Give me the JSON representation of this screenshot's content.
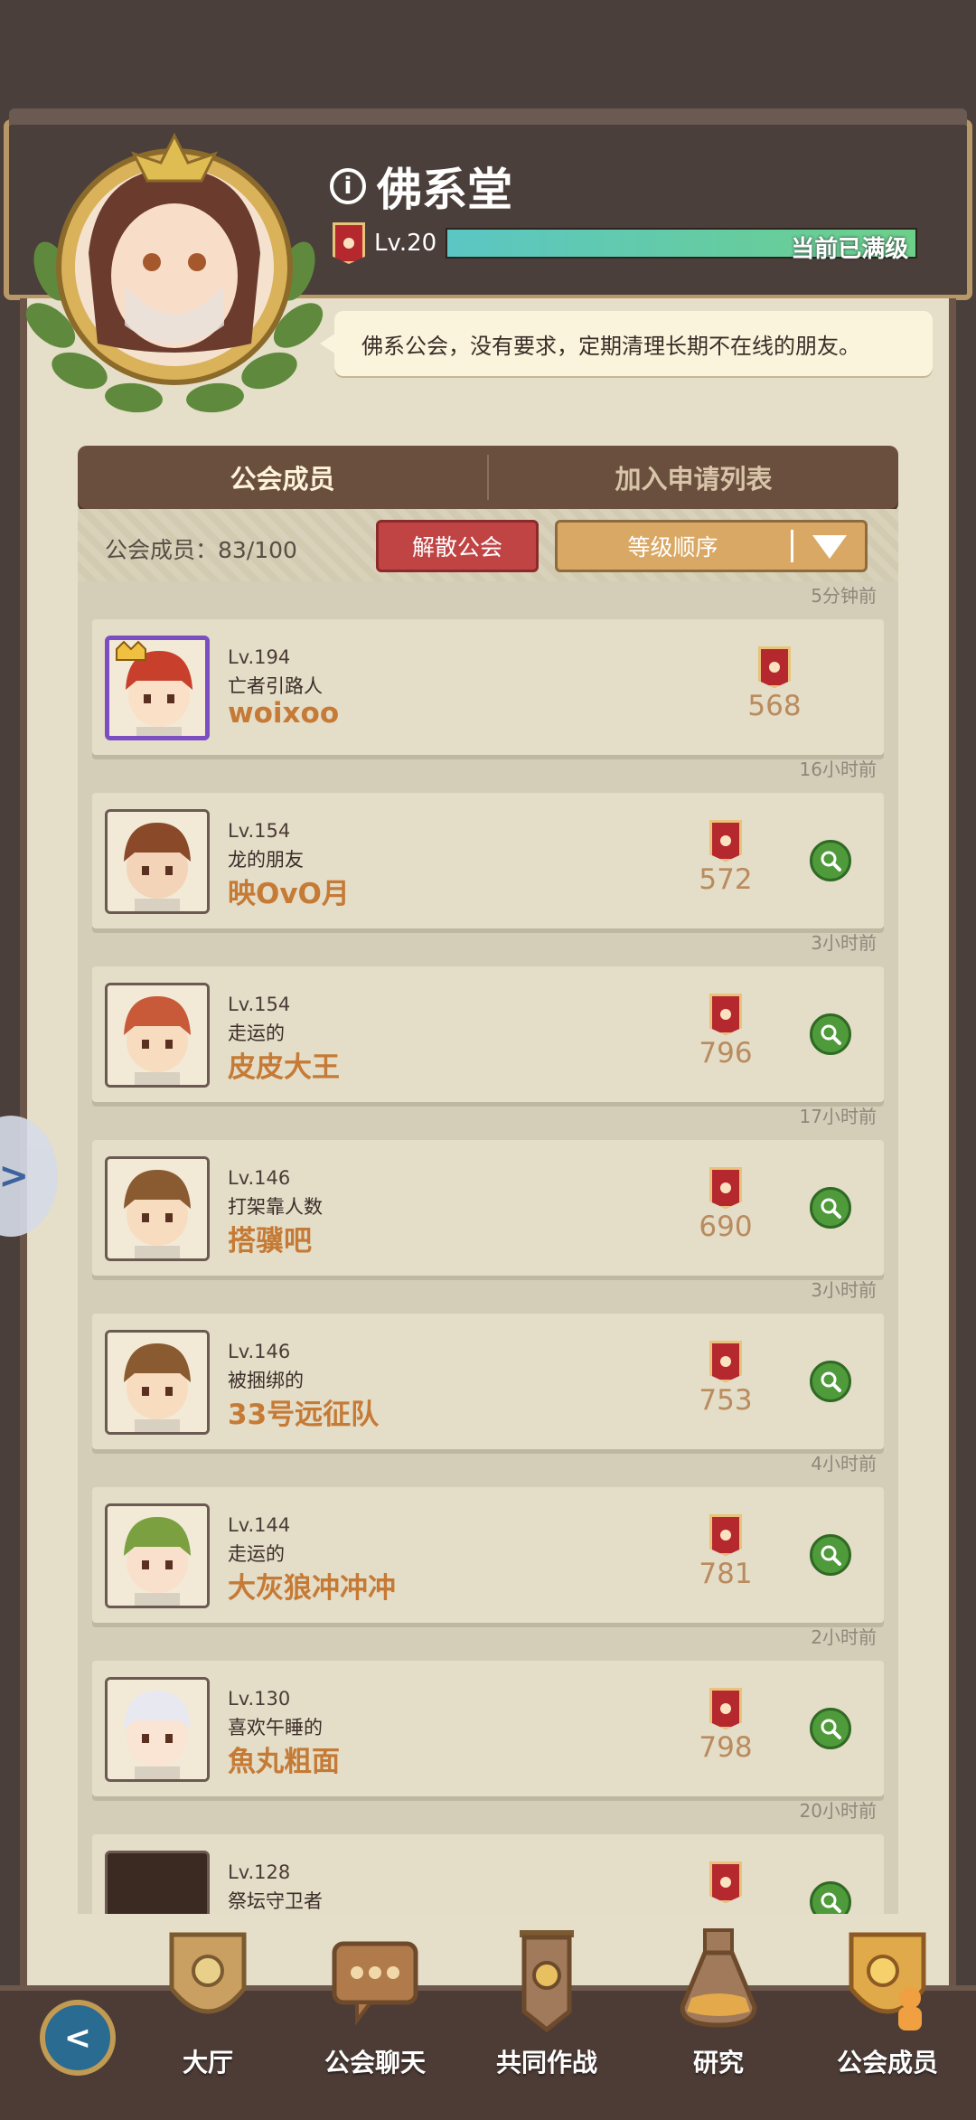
{
  "guild": {
    "name": "佛系堂",
    "level": "Lv.20",
    "level_status": "当前已满级",
    "xp_fraction": 1.0,
    "description": "佛系公会，没有要求，定期清理长期不在线的朋友。"
  },
  "tabs": [
    {
      "label": "公会成员",
      "active": true
    },
    {
      "label": "加入申请列表",
      "active": false
    }
  ],
  "controls": {
    "member_count": "公会成员：83/100",
    "disband_label": "解散公会",
    "sort_label": "等级顺序"
  },
  "members": [
    {
      "time": "5分钟前",
      "level": "Lv.194",
      "title": "亡者引路人",
      "name": "woixoo",
      "power": "568",
      "leader": true
    },
    {
      "time": "16小时前",
      "level": "Lv.154",
      "title": "龙的朋友",
      "name": "映OvO月",
      "power": "572",
      "leader": false
    },
    {
      "time": "3小时前",
      "level": "Lv.154",
      "title": "走运的",
      "name": "皮皮大王",
      "power": "796",
      "leader": false
    },
    {
      "time": "17小时前",
      "level": "Lv.146",
      "title": "打架靠人数",
      "name": "搭骥吧",
      "power": "690",
      "leader": false
    },
    {
      "time": "3小时前",
      "level": "Lv.146",
      "title": "被捆绑的",
      "name": "33号远征队",
      "power": "753",
      "leader": false
    },
    {
      "time": "4小时前",
      "level": "Lv.144",
      "title": "走运的",
      "name": "大灰狼冲冲冲",
      "power": "781",
      "leader": false
    },
    {
      "time": "2小时前",
      "level": "Lv.130",
      "title": "喜欢午睡的",
      "name": "魚丸粗面",
      "power": "798",
      "leader": false
    },
    {
      "time": "20小时前",
      "level": "Lv.128",
      "title": "祭坛守卫者",
      "name": "",
      "power": "",
      "leader": false
    }
  ],
  "nav": [
    {
      "label": "大厅",
      "icon": "hall-icon"
    },
    {
      "label": "公会聊天",
      "icon": "chat-icon"
    },
    {
      "label": "共同作战",
      "icon": "battle-banner-icon"
    },
    {
      "label": "研究",
      "icon": "research-flask-icon"
    },
    {
      "label": "公会成员",
      "icon": "members-icon"
    }
  ],
  "colors": {
    "name_orange": "#c57a35",
    "disband_red": "#c04444",
    "sort_gold": "#d9a864",
    "xp_teal": "#5bc6c4",
    "leader_purple": "#7b4fc2"
  }
}
